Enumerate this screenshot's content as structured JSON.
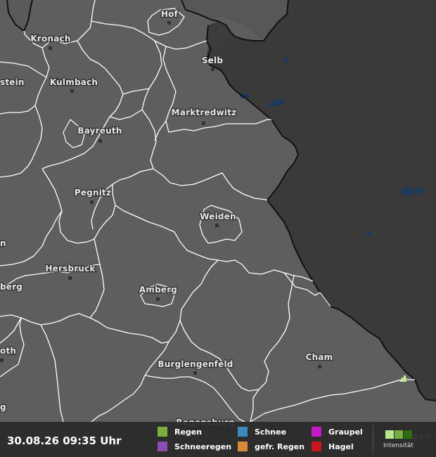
{
  "map": {
    "cities": [
      "Hof",
      "Kronach",
      "Selb",
      "Kulmbach",
      "Marktredwitz",
      "Bayreuth",
      "Pegnitz",
      "Weiden",
      "Hersbruck",
      "Amberg",
      "Cham",
      "Burglengenfeld",
      "Regensburg"
    ],
    "edge_labels": [
      "stein",
      "n",
      "berg",
      "oth",
      "g",
      "egen"
    ]
  },
  "legend": {
    "timestamp": "30.08.26 09:35 Uhr",
    "types": [
      {
        "label": "Regen",
        "color": "#7cae3e"
      },
      {
        "label": "Schneeregen",
        "color": "#8a4db0"
      },
      {
        "label": "Schnee",
        "color": "#3a8ac0"
      },
      {
        "label": "gefr. Regen",
        "color": "#d88a3a"
      },
      {
        "label": "Graupel",
        "color": "#c21ac9"
      },
      {
        "label": "Hagel",
        "color": "#c8161d"
      }
    ],
    "intensity_label": "Intensität",
    "intensity_colors": [
      "#b5e88a",
      "#77ad42",
      "#2f6b12"
    ]
  },
  "colors": {
    "bavaria_fill": "#5e5e5e",
    "foreign_fill": "#3a3a3a",
    "border": "#111111",
    "district_line": "#ffffff",
    "rain_cell": "#c7e89a"
  }
}
